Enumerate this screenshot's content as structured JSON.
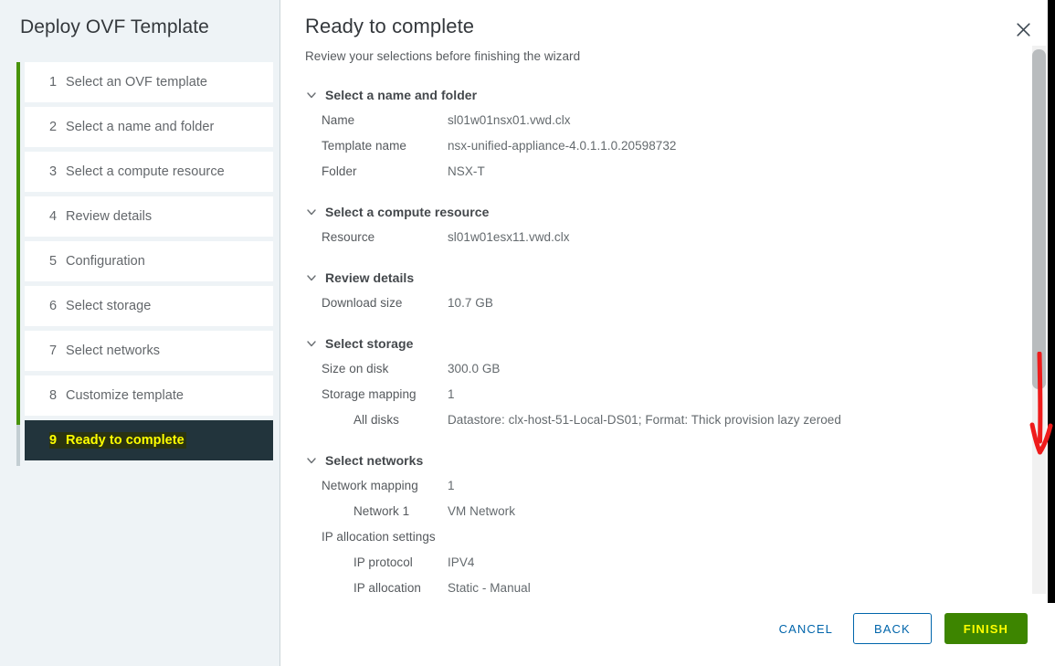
{
  "sidebar": {
    "title": "Deploy OVF Template",
    "steps": [
      {
        "num": "1",
        "label": "Select an OVF template",
        "active": false
      },
      {
        "num": "2",
        "label": "Select a name and folder",
        "active": false
      },
      {
        "num": "3",
        "label": "Select a compute resource",
        "active": false
      },
      {
        "num": "4",
        "label": "Review details",
        "active": false
      },
      {
        "num": "5",
        "label": "Configuration",
        "active": false
      },
      {
        "num": "6",
        "label": "Select storage",
        "active": false
      },
      {
        "num": "7",
        "label": "Select networks",
        "active": false
      },
      {
        "num": "8",
        "label": "Customize template",
        "active": false
      },
      {
        "num": "9",
        "label": "Ready to complete",
        "active": true
      }
    ]
  },
  "main": {
    "title": "Ready to complete",
    "subtitle": "Review your selections before finishing the wizard",
    "close_icon": "close-icon",
    "sections": [
      {
        "header": "Select a name and folder",
        "expanded": true,
        "rows": [
          {
            "label": "Name",
            "value": "sl01w01nsx01.vwd.clx",
            "indent": false
          },
          {
            "label": "Template name",
            "value": "nsx-unified-appliance-4.0.1.1.0.20598732",
            "indent": false
          },
          {
            "label": "Folder",
            "value": "NSX-T",
            "indent": false
          }
        ]
      },
      {
        "header": "Select a compute resource",
        "expanded": true,
        "rows": [
          {
            "label": "Resource",
            "value": "sl01w01esx11.vwd.clx",
            "indent": false
          }
        ]
      },
      {
        "header": "Review details",
        "expanded": true,
        "rows": [
          {
            "label": "Download size",
            "value": "10.7 GB",
            "indent": false
          }
        ]
      },
      {
        "header": "Select storage",
        "expanded": true,
        "rows": [
          {
            "label": "Size on disk",
            "value": "300.0 GB",
            "indent": false
          },
          {
            "label": "Storage mapping",
            "value": "1",
            "indent": false
          },
          {
            "label": "All disks",
            "value": "Datastore: clx-host-51-Local-DS01; Format: Thick provision lazy zeroed",
            "indent": true
          }
        ]
      },
      {
        "header": "Select networks",
        "expanded": true,
        "rows": [
          {
            "label": "Network mapping",
            "value": "1",
            "indent": false
          },
          {
            "label": "Network 1",
            "value": "VM Network",
            "indent": true
          },
          {
            "label": "IP allocation settings",
            "value": "",
            "indent": false
          },
          {
            "label": "IP protocol",
            "value": "IPV4",
            "indent": true
          },
          {
            "label": "IP allocation",
            "value": "Static - Manual",
            "indent": true
          }
        ]
      }
    ]
  },
  "footer": {
    "cancel_label": "CANCEL",
    "back_label": "BACK",
    "finish_label": "FINISH"
  },
  "annotation": {
    "type": "red-down-arrow",
    "color": "#ee1b1b"
  },
  "colors": {
    "sidebar_bg": "#eef3f6",
    "rail_green": "#48930b",
    "active_step_bg": "#22343c",
    "active_step_text": "#ffff00",
    "link_blue": "#0065ab",
    "finish_green": "#3d8500",
    "scrollbar_thumb": "#b9bcbe"
  }
}
